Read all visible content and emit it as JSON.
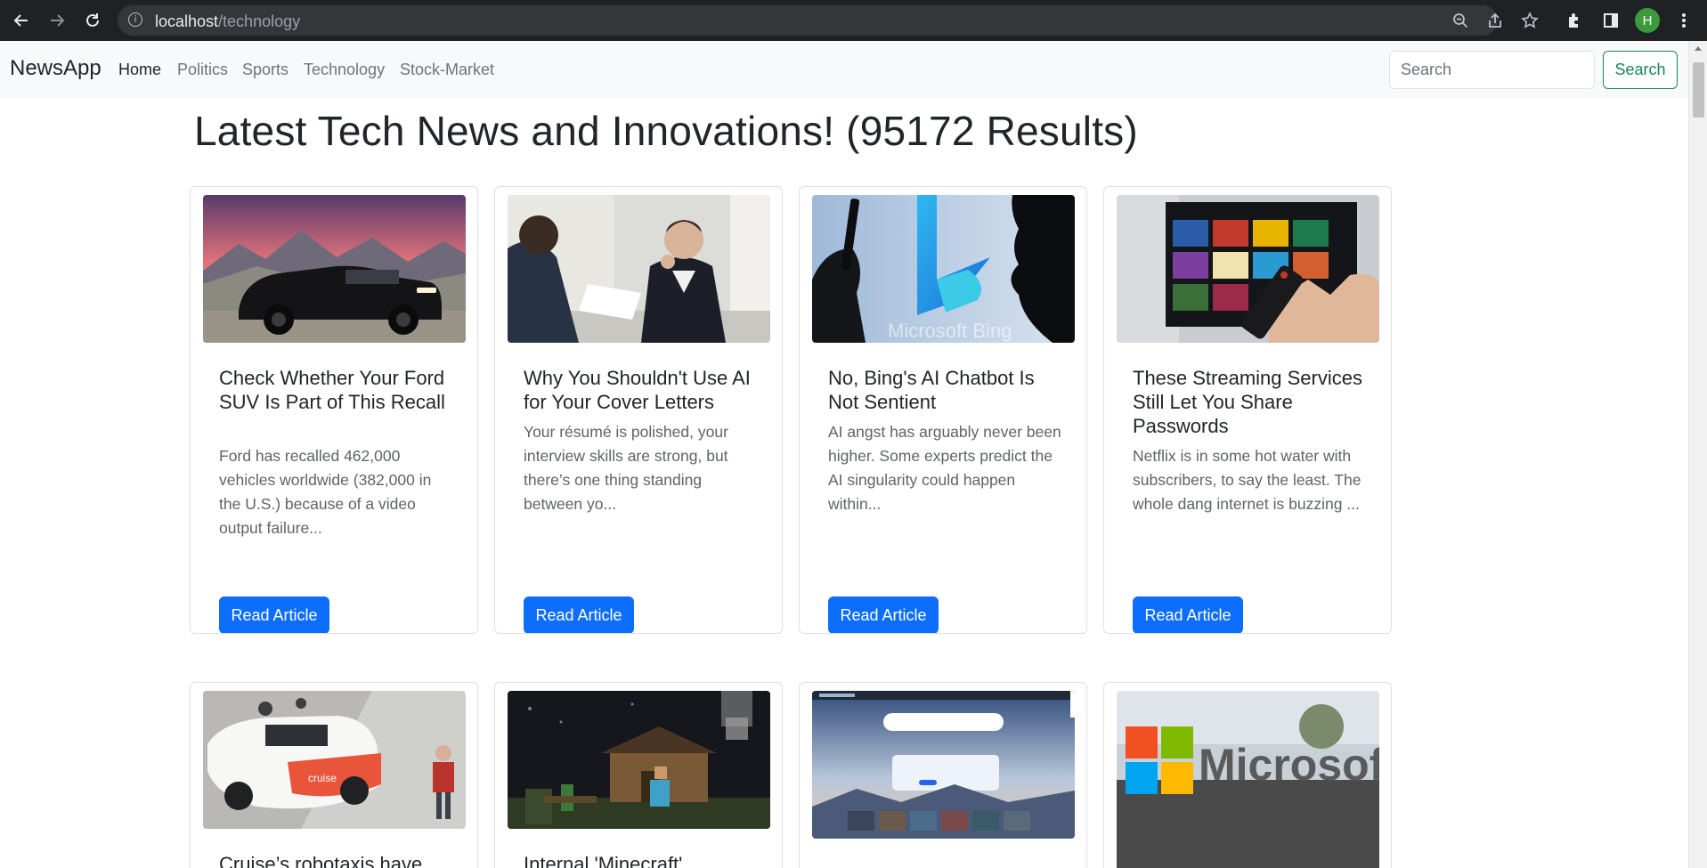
{
  "browser": {
    "url_host": "localhost",
    "url_path": "/technology",
    "profile_initial": "H"
  },
  "navbar": {
    "brand": "NewsApp",
    "links": [
      {
        "label": "Home",
        "active": true
      },
      {
        "label": "Politics",
        "active": false
      },
      {
        "label": "Sports",
        "active": false
      },
      {
        "label": "Technology",
        "active": false
      },
      {
        "label": "Stock-Market",
        "active": false
      }
    ],
    "search_placeholder": "Search",
    "search_button": "Search"
  },
  "page": {
    "title": "Latest Tech News and Innovations! (95172 Results)"
  },
  "articles": [
    {
      "title": "Check Whether Your Ford SUV Is Part of This Recall",
      "description": "Ford has recalled 462,000 vehicles worldwide (382,000 in the U.S.) because of a video output failure...",
      "button": "Read Article",
      "image": "black-suv-mountains"
    },
    {
      "title": "Why You Shouldn't Use AI for Your Cover Letters",
      "description": "Your résumé is polished, your interview skills are strong, but there’s one thing standing between yo...",
      "button": "Read Article",
      "image": "job-interview"
    },
    {
      "title": "No, Bing's AI Chatbot Is Not Sentient",
      "description": "AI angst has arguably never been higher. Some experts predict the AI singularity could happen within...",
      "button": "Read Article",
      "image": "bing-logo-silhouette",
      "image_caption": "Microsoft Bing"
    },
    {
      "title": "These Streaming Services Still Let You Share Passwords",
      "description": "Netflix is in some hot water with subscribers, to say the least. The whole dang internet is buzzing ...",
      "button": "Read Article",
      "image": "tv-remote"
    },
    {
      "title": "Cruise’s robotaxis have",
      "image": "cruise-robotaxi",
      "image_caption": "cruise"
    },
    {
      "title": "Internal 'Minecraft'",
      "image": "minecraft-scene"
    },
    {
      "title": "",
      "image": "bing-homepage-screenshot"
    },
    {
      "title": "",
      "image": "microsoft-sign",
      "image_caption": "Microsoft"
    }
  ]
}
